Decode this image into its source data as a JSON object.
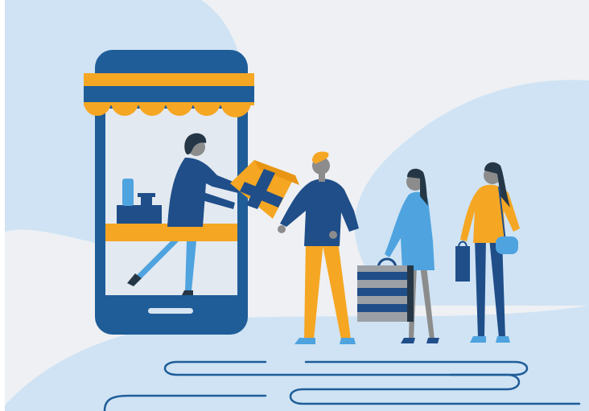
{
  "illustration": {
    "subject": "online-shop-queue",
    "colors": {
      "background": "#eef0f3",
      "blob": "#cfe3f4",
      "phone": "#1f5d99",
      "screen": "#e3e9f0",
      "awning": "#f5a623",
      "person_navy": "#1f4e89",
      "person_light_blue": "#4fa3df",
      "skin": "#8c8c8c",
      "hair": "#253746",
      "bag_grey": "#9aa0a6",
      "path_line": "#1f5d99"
    }
  }
}
